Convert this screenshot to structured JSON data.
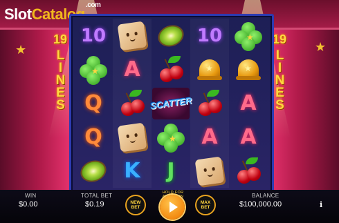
{
  "brand": {
    "logo_left": "Slot",
    "logo_right": "Catalog",
    "logo_suffix": ".com"
  },
  "side_panels": {
    "lines_count": "19",
    "lines_word": "LINES"
  },
  "reels": [
    [
      "10",
      "clover",
      "Q",
      "Q",
      "kiwi"
    ],
    [
      "dice",
      "A",
      "cherry",
      "dice",
      "K"
    ],
    [
      "kiwi",
      "cherry",
      "scatter",
      "clover",
      "J"
    ],
    [
      "10",
      "bell",
      "cherry",
      "A",
      "dice"
    ],
    [
      "clover",
      "bell",
      "A",
      "A",
      "cherry"
    ]
  ],
  "scatter_label": "SCATTER",
  "bottom_bar": {
    "win_label": "WIN",
    "win_value": "$0.00",
    "total_bet_label": "TOTAL BET",
    "total_bet_value": "$0.19",
    "new_bet_label": "NEW BET",
    "hold_label": "HOLD FOR AUTOSPIN",
    "max_bet_label": "MAX BET",
    "balance_label": "BALANCE",
    "balance_value": "$100,000.00",
    "info_label": "i"
  },
  "icons": {
    "spin": "play-triangle-icon",
    "info": "info-icon"
  },
  "colors": {
    "accent": "#f38a10",
    "frame": "#2d3bb0",
    "gold": "#ffd640"
  }
}
